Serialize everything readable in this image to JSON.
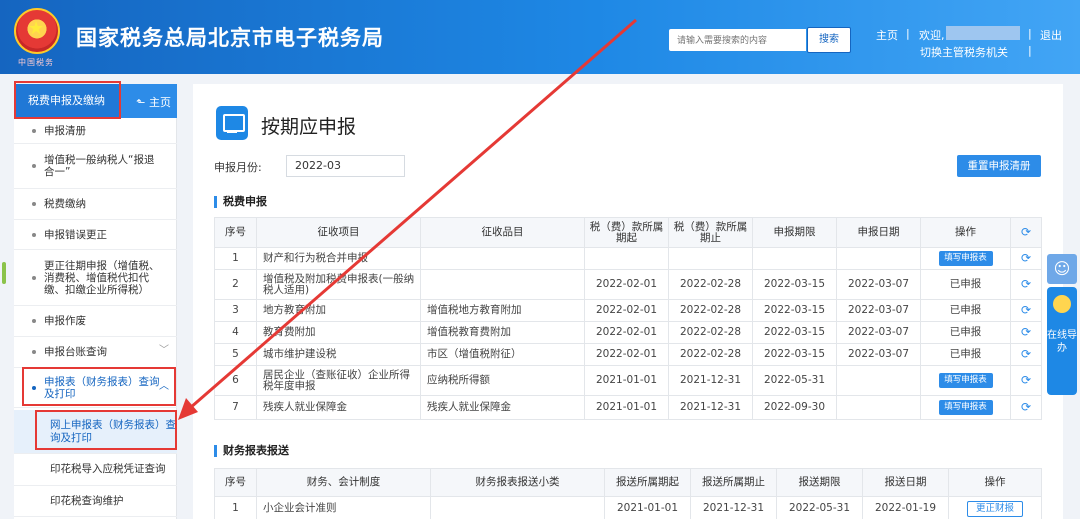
{
  "header": {
    "site_title": "国家税务总局北京市电子税务局",
    "search_placeholder": "请输入需要搜索的内容",
    "search_button": "搜索",
    "home": "主页",
    "separator": "|",
    "welcome": "欢迎,",
    "logout": "退出",
    "switch_authority": "切换主管税务机关",
    "emblem_caption": "中国税务"
  },
  "sidebar": {
    "title": "税费申报及缴纳",
    "home": "主页",
    "items": [
      {
        "label": "申报清册"
      },
      {
        "label": "增值税一般纳税人“报退合一”"
      },
      {
        "label": "税费缴纳"
      },
      {
        "label": "申报错误更正"
      },
      {
        "label": "更正往期申报（增值税、消费税、增值税代扣代缴、扣缴企业所得税）"
      },
      {
        "label": "申报作废"
      },
      {
        "label": "申报台账查询"
      },
      {
        "label": "申报表（财务报表）查询及打印"
      }
    ],
    "sub_items": [
      {
        "label": "网上申报表（财务报表）查询及打印"
      },
      {
        "label": "印花税导入应税凭证查询"
      },
      {
        "label": "印花税查询维护"
      }
    ]
  },
  "main": {
    "page_title": "按期应申报",
    "period_label": "申报月份:",
    "period_value": "2022-03",
    "reset_button": "重置申报清册",
    "tax_section": "税费申报",
    "tax_headers": [
      "序号",
      "征收项目",
      "征收品目",
      "税（费）款所属期起",
      "税（费）款所属期止",
      "申报期限",
      "申报日期",
      "操作"
    ],
    "tax_rows": [
      {
        "no": "1",
        "item": "财产和行为税合并申报",
        "sub": "",
        "start": "",
        "end": "",
        "deadline": "",
        "date": "",
        "op": "填写申报表",
        "op_type": "button"
      },
      {
        "no": "2",
        "item": "增值税及附加税费申报表(一般纳税人适用)",
        "sub": "",
        "start": "2022-02-01",
        "end": "2022-02-28",
        "deadline": "2022-03-15",
        "date": "2022-03-07",
        "op": "已申报",
        "op_type": "text"
      },
      {
        "no": "3",
        "item": "地方教育附加",
        "sub": "增值税地方教育附加",
        "start": "2022-02-01",
        "end": "2022-02-28",
        "deadline": "2022-03-15",
        "date": "2022-03-07",
        "op": "已申报",
        "op_type": "text"
      },
      {
        "no": "4",
        "item": "教育费附加",
        "sub": "增值税教育费附加",
        "start": "2022-02-01",
        "end": "2022-02-28",
        "deadline": "2022-03-15",
        "date": "2022-03-07",
        "op": "已申报",
        "op_type": "text"
      },
      {
        "no": "5",
        "item": "城市维护建设税",
        "sub": "市区（增值税附征）",
        "start": "2022-02-01",
        "end": "2022-02-28",
        "deadline": "2022-03-15",
        "date": "2022-03-07",
        "op": "已申报",
        "op_type": "text"
      },
      {
        "no": "6",
        "item": "居民企业（查账征收）企业所得税年度申报",
        "sub": "应纳税所得额",
        "start": "2021-01-01",
        "end": "2021-12-31",
        "deadline": "2022-05-31",
        "date": "",
        "op": "填写申报表",
        "op_type": "button"
      },
      {
        "no": "7",
        "item": "残疾人就业保障金",
        "sub": "残疾人就业保障金",
        "start": "2021-01-01",
        "end": "2021-12-31",
        "deadline": "2022-09-30",
        "date": "",
        "op": "填写申报表",
        "op_type": "button"
      }
    ],
    "fin_section": "财务报表报送",
    "fin_headers": [
      "序号",
      "财务、会计制度",
      "财务报表报送小类",
      "报送所属期起",
      "报送所属期止",
      "报送期限",
      "报送日期",
      "操作"
    ],
    "fin_rows": [
      {
        "no": "1",
        "system": "小企业会计准则",
        "sub": "",
        "start": "2021-01-01",
        "end": "2021-12-31",
        "deadline": "2022-05-31",
        "date": "2022-01-19",
        "op": "更正财报"
      }
    ]
  },
  "float_widget": {
    "text": "在线导办"
  }
}
